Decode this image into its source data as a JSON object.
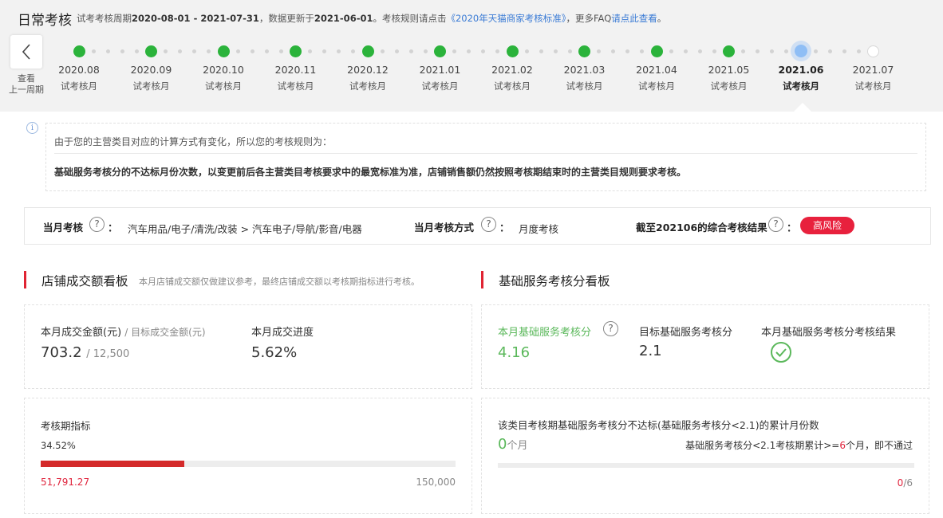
{
  "header": {
    "title": "日常考核",
    "period_prefix": "试考考核周期",
    "period_range": "2020-08-01 - 2021-07-31",
    "updated_prefix": "，数据更新于",
    "updated_date": "2021-06-01",
    "rule_prefix": "。考核规则请点击",
    "rule_link": "《2020年天猫商家考核标准》",
    "faq_prefix": "，更多FAQ",
    "faq_link": "请点此查看",
    "faq_suffix": "。"
  },
  "timeline": {
    "prev_label_1": "查看",
    "prev_label_2": "上一周期",
    "months": [
      {
        "month": "2020.08",
        "sub": "试考核月",
        "status": "done"
      },
      {
        "month": "2020.09",
        "sub": "试考核月",
        "status": "done"
      },
      {
        "month": "2020.10",
        "sub": "试考核月",
        "status": "done"
      },
      {
        "month": "2020.11",
        "sub": "试考核月",
        "status": "done"
      },
      {
        "month": "2020.12",
        "sub": "试考核月",
        "status": "done"
      },
      {
        "month": "2021.01",
        "sub": "试考核月",
        "status": "done"
      },
      {
        "month": "2021.02",
        "sub": "试考核月",
        "status": "done"
      },
      {
        "month": "2021.03",
        "sub": "试考核月",
        "status": "done"
      },
      {
        "month": "2021.04",
        "sub": "试考核月",
        "status": "done"
      },
      {
        "month": "2021.05",
        "sub": "试考核月",
        "status": "done"
      },
      {
        "month": "2021.06",
        "sub": "试考核月",
        "status": "current"
      },
      {
        "month": "2021.07",
        "sub": "试考核月",
        "status": "future"
      }
    ]
  },
  "notice": {
    "line1": "由于您的主营类目对应的计算方式有变化，所以您的考核规则为：",
    "line2": "基础服务考核分的不达标月份次数，以变更前后各主营类目考核要求中的最宽标准为准，店铺销售额仍然按照考核期结束时的主营类目规则要求考核。"
  },
  "assessment": {
    "month_label": "当月考核",
    "category": "汽车用品/电子/清洗/改装 > 汽车电子/导航/影音/电器",
    "method_label": "当月考核方式",
    "method_value": "月度考核",
    "result_label": "截至202106的综合考核结果",
    "result_badge": "高风险",
    "colon": "：",
    "help": "?"
  },
  "sales": {
    "title": "店铺成交额看板",
    "note": "本月店铺成交额仅做建议参考，最终店铺成交额以考核期指标进行考核。",
    "amount_label": "本月成交金额(元)",
    "target_label": "/ 目标成交金额(元)",
    "amount_value": "703.2",
    "target_value": "/ 12,500",
    "progress_label": "本月成交进度",
    "progress_value": "5.62%",
    "period_title": "考核期指标",
    "period_percent": "34.52%",
    "period_fraction": 0.3452,
    "period_current": "51,791.27",
    "period_target": "150,000"
  },
  "service": {
    "title": "基础服务考核分看板",
    "score_label": "本月基础服务考核分",
    "score_value": "4.16",
    "target_label": "目标基础服务考核分",
    "target_value": "2.1",
    "result_label": "本月基础服务考核分考核结果",
    "fail_title": "该类目考核期基础服务考核分不达标(基础服务考核分<2.1)的累计月份数",
    "fail_count": "0",
    "fail_unit": "个月",
    "rule_prefix": "基础服务考核分<2.1考核期累计>=",
    "rule_num": "6",
    "rule_suffix": "个月，即不通过",
    "fraction_current": "0",
    "fraction_total": "/6"
  },
  "colors": {
    "green": "#2bb33b",
    "red": "#e0243c",
    "link": "#3a7bd5"
  }
}
